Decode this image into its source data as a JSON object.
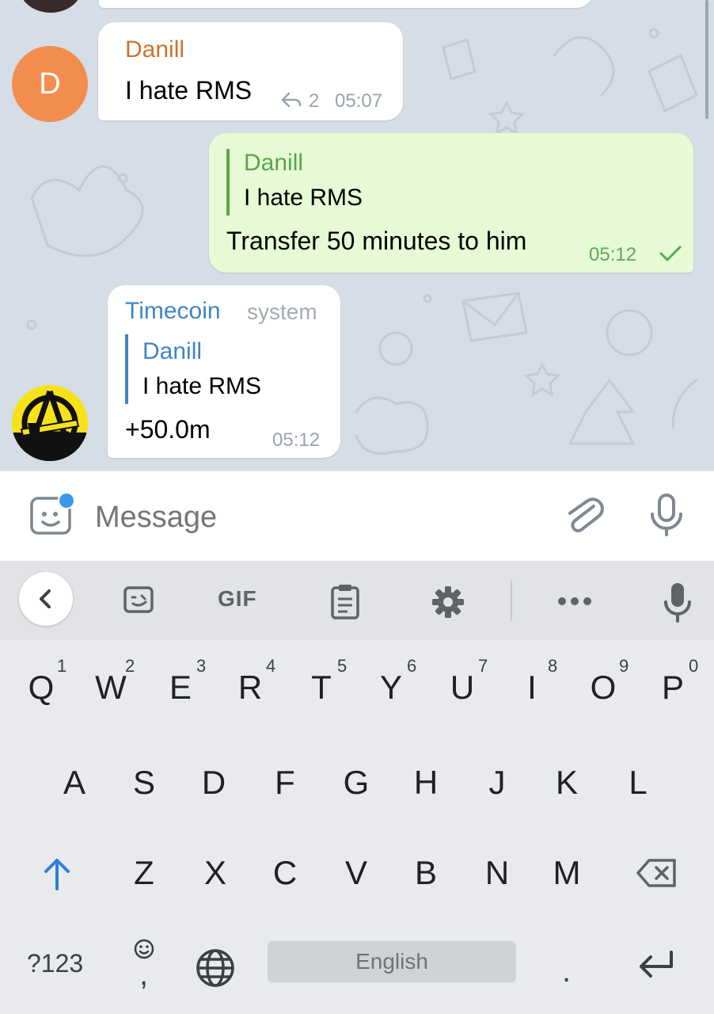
{
  "messages": [
    {
      "sender": "Danill",
      "text": "I hate RMS",
      "reply_count": "2",
      "time": "05:07",
      "avatar_letter": "D"
    },
    {
      "quote_name": "Danill",
      "quote_text": "I hate RMS",
      "text": "Transfer 50 minutes to him",
      "time": "05:12"
    },
    {
      "sender": "Timecoin",
      "sender_tag": "system",
      "quote_name": "Danill",
      "quote_text": "I hate RMS",
      "text": "+50.0m",
      "time": "05:12"
    }
  ],
  "input": {
    "placeholder": "Message"
  },
  "keyboard": {
    "toolbar": {
      "gif_label": "GIF"
    },
    "row1": [
      "Q",
      "W",
      "E",
      "R",
      "T",
      "Y",
      "U",
      "I",
      "O",
      "P"
    ],
    "row1_hints": [
      "1",
      "2",
      "3",
      "4",
      "5",
      "6",
      "7",
      "8",
      "9",
      "0"
    ],
    "row2": [
      "A",
      "S",
      "D",
      "F",
      "G",
      "H",
      "J",
      "K",
      "L"
    ],
    "row3": [
      "Z",
      "X",
      "C",
      "V",
      "B",
      "N",
      "M"
    ],
    "symbols_label": "?123",
    "comma_label": ",",
    "space_label": "English",
    "period_label": "."
  },
  "colors": {
    "chat_bg": "#d5dde6",
    "out_bubble": "#e6fbd5",
    "danill_name": "#c8742f",
    "quote_green": "#5ba44a",
    "timecoin_name": "#3f86c5",
    "avatar_orange": "#f28d4f",
    "accent_blue": "#2e7fd6",
    "check_green": "#4fae4e"
  },
  "icons": [
    "reply-icon",
    "check-icon",
    "sticker-icon",
    "attach-icon",
    "mic-icon",
    "back-arrow-icon",
    "emoji-sticker-icon",
    "clipboard-icon",
    "gear-icon",
    "more-icon",
    "shift-icon",
    "backspace-icon",
    "globe-icon",
    "enter-icon",
    "smiley-icon"
  ]
}
